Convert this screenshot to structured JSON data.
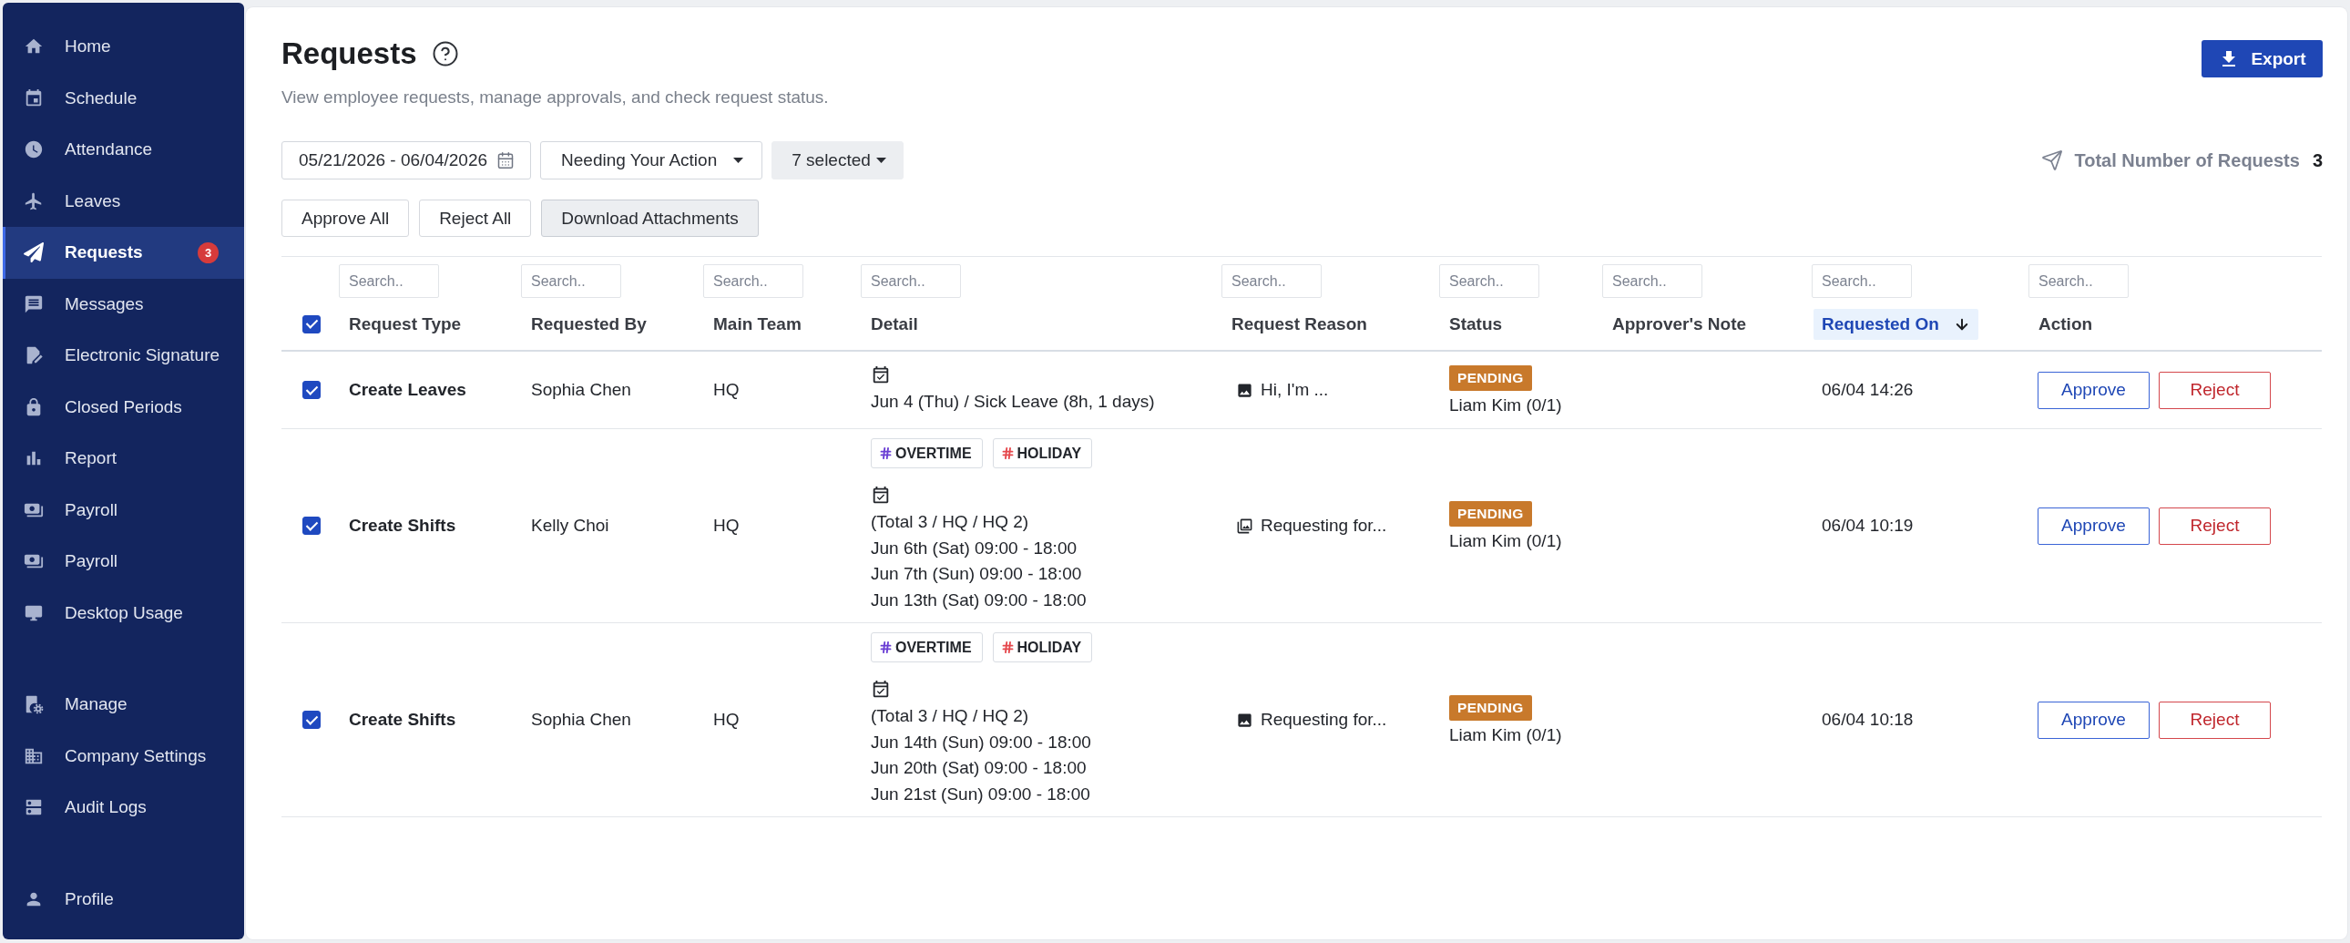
{
  "sidebar": {
    "sections": [
      {
        "items": [
          {
            "label": "Home",
            "selected": false
          },
          {
            "label": "Schedule",
            "selected": false
          },
          {
            "label": "Attendance",
            "selected": false
          },
          {
            "label": "Leaves",
            "selected": false
          },
          {
            "label": "Requests",
            "selected": true,
            "badge": "3"
          },
          {
            "label": "Messages",
            "selected": false
          },
          {
            "label": "Electronic Signature",
            "selected": false
          },
          {
            "label": "Closed Periods",
            "selected": false
          },
          {
            "label": "Report",
            "selected": false
          },
          {
            "label": "Payroll",
            "selected": false
          },
          {
            "label": "Payroll",
            "selected": false
          },
          {
            "label": "Desktop Usage",
            "selected": false
          }
        ]
      },
      {
        "items": [
          {
            "label": "Manage",
            "selected": false
          },
          {
            "label": "Company Settings",
            "selected": false
          },
          {
            "label": "Audit Logs",
            "selected": false
          }
        ]
      },
      {
        "items": [
          {
            "label": "Profile",
            "selected": false
          }
        ]
      }
    ]
  },
  "header": {
    "title": "Requests",
    "subtitle": "View employee requests, manage approvals, and check request status.",
    "export_button": "Export"
  },
  "filters": [
    {
      "kind": "date",
      "value": "05/21/2026 - 06/04/2026"
    },
    {
      "kind": "dropdown",
      "value": "Needing Your Action"
    },
    {
      "kind": "multiselect",
      "value": "7 selected"
    }
  ],
  "total": {
    "label": "Total Number of Requests",
    "value": "3"
  },
  "bulk_actions": [
    {
      "label": "Approve All",
      "kind": "outline"
    },
    {
      "label": "Reject All",
      "kind": "outline"
    },
    {
      "label": "Download Attachments",
      "kind": "filled"
    }
  ],
  "table": {
    "select_all": {
      "checked": true
    },
    "columns": [
      {
        "label": "Request Type",
        "placeholder": "Search..",
        "sorted": false
      },
      {
        "label": "Requested By",
        "placeholder": "Search..",
        "sorted": false
      },
      {
        "label": "Main Team",
        "placeholder": "Search..",
        "sorted": false
      },
      {
        "label": "Detail",
        "placeholder": "Search..",
        "sorted": false
      },
      {
        "label": "Request Reason",
        "placeholder": "Search..",
        "sorted": false
      },
      {
        "label": "Status",
        "placeholder": "Search..",
        "sorted": false
      },
      {
        "label": "Approver's Note",
        "placeholder": "Search..",
        "sorted": false
      },
      {
        "label": "Requested On",
        "placeholder": "Search..",
        "sorted": true
      },
      {
        "label": "Action",
        "placeholder": "Search..",
        "sorted": false
      }
    ],
    "rows": [
      {
        "checked": true,
        "request_type": "Create Leaves",
        "requested_by": "Sophia Chen",
        "main_team": "HQ",
        "detail": {
          "lines": [
            "Jun 4 (Thu) / Sick Leave (8h, 1 days)"
          ]
        },
        "reason": {
          "kind": "image",
          "text": "Hi, I'm ..."
        },
        "status": {
          "badge": "PENDING",
          "approver": "Liam Kim (0/1)"
        },
        "requested_on": "06/04 14:26",
        "actions": [
          {
            "label": "Approve",
            "kind": "approve"
          },
          {
            "label": "Reject",
            "kind": "reject"
          }
        ]
      },
      {
        "checked": true,
        "request_type": "Create Shifts",
        "requested_by": "Kelly Choi",
        "main_team": "HQ",
        "detail": {
          "tags": [
            {
              "label": "OVERTIME",
              "color": "#6b3fd4"
            },
            {
              "label": "HOLIDAY",
              "color": "#e5484d"
            }
          ],
          "lines": [
            "(Total 3 / HQ / HQ 2)",
            "Jun 6th (Sat) 09:00 - 18:00",
            "Jun 7th (Sun) 09:00 - 18:00",
            "Jun 13th (Sat) 09:00 - 18:00"
          ]
        },
        "reason": {
          "kind": "images",
          "text": "Requesting for..."
        },
        "status": {
          "badge": "PENDING",
          "approver": "Liam Kim (0/1)"
        },
        "requested_on": "06/04 10:19",
        "actions": [
          {
            "label": "Approve",
            "kind": "approve"
          },
          {
            "label": "Reject",
            "kind": "reject"
          }
        ]
      },
      {
        "checked": true,
        "request_type": "Create Shifts",
        "requested_by": "Sophia Chen",
        "main_team": "HQ",
        "detail": {
          "tags": [
            {
              "label": "OVERTIME",
              "color": "#6b3fd4"
            },
            {
              "label": "HOLIDAY",
              "color": "#e5484d"
            }
          ],
          "lines": [
            "(Total 3 / HQ / HQ 2)",
            "Jun 14th (Sun) 09:00 - 18:00",
            "Jun 20th (Sat) 09:00 - 18:00",
            "Jun 21st (Sun) 09:00 - 18:00"
          ]
        },
        "reason": {
          "kind": "image",
          "text": "Requesting for..."
        },
        "status": {
          "badge": "PENDING",
          "approver": "Liam Kim (0/1)"
        },
        "requested_on": "06/04 10:18",
        "actions": [
          {
            "label": "Approve",
            "kind": "approve"
          },
          {
            "label": "Reject",
            "kind": "reject"
          }
        ]
      }
    ]
  }
}
